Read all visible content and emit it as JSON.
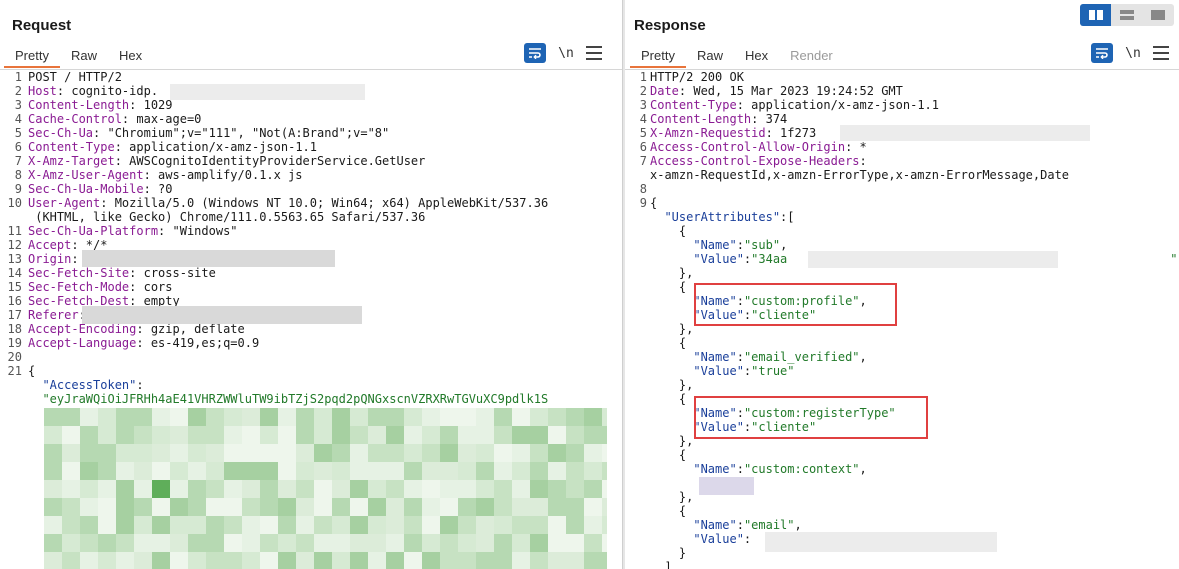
{
  "request": {
    "title": "Request",
    "tabs": [
      "Pretty",
      "Raw",
      "Hex"
    ],
    "newline_toggle": "\\n",
    "lines": [
      {
        "n": "1",
        "parts": [
          {
            "t": "POST / HTTP/2",
            "c": ""
          }
        ]
      },
      {
        "n": "2",
        "parts": [
          {
            "t": "Host",
            "c": "hn"
          },
          {
            "t": ": cognito-idp.",
            "c": ""
          }
        ]
      },
      {
        "n": "3",
        "parts": [
          {
            "t": "Content-Length",
            "c": "hn"
          },
          {
            "t": ": 1029",
            "c": ""
          }
        ]
      },
      {
        "n": "4",
        "parts": [
          {
            "t": "Cache-Control",
            "c": "hn"
          },
          {
            "t": ": max-age=0",
            "c": ""
          }
        ]
      },
      {
        "n": "5",
        "parts": [
          {
            "t": "Sec-Ch-Ua",
            "c": "hn"
          },
          {
            "t": ": \"Chromium\";v=\"111\", \"Not(A:Brand\";v=\"8\"",
            "c": ""
          }
        ]
      },
      {
        "n": "6",
        "parts": [
          {
            "t": "Content-Type",
            "c": "hn"
          },
          {
            "t": ": application/x-amz-json-1.1",
            "c": ""
          }
        ]
      },
      {
        "n": "7",
        "parts": [
          {
            "t": "X-Amz-Target",
            "c": "hn"
          },
          {
            "t": ": AWSCognitoIdentityProviderService.GetUser",
            "c": ""
          }
        ]
      },
      {
        "n": "8",
        "parts": [
          {
            "t": "X-Amz-User-Agent",
            "c": "hn"
          },
          {
            "t": ": aws-amplify/0.1.x js",
            "c": ""
          }
        ]
      },
      {
        "n": "9",
        "parts": [
          {
            "t": "Sec-Ch-Ua-Mobile",
            "c": "hn"
          },
          {
            "t": ": ?0",
            "c": ""
          }
        ]
      },
      {
        "n": "10",
        "parts": [
          {
            "t": "User-Agent",
            "c": "hn"
          },
          {
            "t": ": Mozilla/5.0 (Windows NT 10.0; Win64; x64) AppleWebKit/537.36",
            "c": ""
          }
        ]
      },
      {
        "n": "",
        "parts": [
          {
            "t": " (KHTML, like Gecko) Chrome/111.0.5563.65 Safari/537.36",
            "c": ""
          }
        ]
      },
      {
        "n": "11",
        "parts": [
          {
            "t": "Sec-Ch-Ua-Platform",
            "c": "hn"
          },
          {
            "t": ": \"Windows\"",
            "c": ""
          }
        ]
      },
      {
        "n": "12",
        "parts": [
          {
            "t": "Accept",
            "c": "hn"
          },
          {
            "t": ": */*",
            "c": ""
          }
        ]
      },
      {
        "n": "13",
        "parts": [
          {
            "t": "Origin",
            "c": "hn"
          },
          {
            "t": ":",
            "c": ""
          }
        ]
      },
      {
        "n": "14",
        "parts": [
          {
            "t": "Sec-Fetch-Site",
            "c": "hn"
          },
          {
            "t": ": cross-site",
            "c": ""
          }
        ]
      },
      {
        "n": "15",
        "parts": [
          {
            "t": "Sec-Fetch-Mode",
            "c": "hn"
          },
          {
            "t": ": cors",
            "c": ""
          }
        ]
      },
      {
        "n": "16",
        "parts": [
          {
            "t": "Sec-Fetch-Dest",
            "c": "hn"
          },
          {
            "t": ": empty",
            "c": ""
          }
        ]
      },
      {
        "n": "17",
        "parts": [
          {
            "t": "Referer",
            "c": "hn"
          },
          {
            "t": ":",
            "c": ""
          }
        ]
      },
      {
        "n": "18",
        "parts": [
          {
            "t": "Accept-Encoding",
            "c": "hn"
          },
          {
            "t": ": gzip, deflate",
            "c": ""
          }
        ]
      },
      {
        "n": "19",
        "parts": [
          {
            "t": "Accept-Language",
            "c": "hn"
          },
          {
            "t": ": es-419,es;q=0.9",
            "c": ""
          }
        ]
      },
      {
        "n": "20",
        "parts": []
      },
      {
        "n": "21",
        "parts": [
          {
            "t": "{",
            "c": "jp"
          }
        ]
      },
      {
        "n": "",
        "parts": [
          {
            "t": "  \"AccessToken\"",
            "c": "jk"
          },
          {
            "t": ":",
            "c": "jp"
          }
        ]
      },
      {
        "n": "",
        "parts": [
          {
            "t": "  \"eyJraWQiOiJFRHh4aE41VHRZWWluTW9ibTZjS2pqd2pQNGxscnVZRXRwTGVuXC9pdlk1S",
            "c": "js"
          }
        ]
      }
    ]
  },
  "response": {
    "title": "Response",
    "tabs": [
      "Pretty",
      "Raw",
      "Hex",
      "Render"
    ],
    "newline_toggle": "\\n",
    "lines": [
      {
        "n": "1",
        "parts": [
          {
            "t": "HTTP/2 200 OK",
            "c": ""
          }
        ]
      },
      {
        "n": "2",
        "parts": [
          {
            "t": "Date",
            "c": "hn"
          },
          {
            "t": ": Wed, 15 Mar 2023 19:24:52 GMT",
            "c": ""
          }
        ]
      },
      {
        "n": "3",
        "parts": [
          {
            "t": "Content-Type",
            "c": "hn"
          },
          {
            "t": ": application/x-amz-json-1.1",
            "c": ""
          }
        ]
      },
      {
        "n": "4",
        "parts": [
          {
            "t": "Content-Length",
            "c": "hn"
          },
          {
            "t": ": 374",
            "c": ""
          }
        ]
      },
      {
        "n": "5",
        "parts": [
          {
            "t": "X-Amzn-Requestid",
            "c": "hn"
          },
          {
            "t": ": 1f273",
            "c": ""
          }
        ]
      },
      {
        "n": "6",
        "parts": [
          {
            "t": "Access-Control-Allow-Origin",
            "c": "hn"
          },
          {
            "t": ": *",
            "c": ""
          }
        ]
      },
      {
        "n": "7",
        "parts": [
          {
            "t": "Access-Control-Expose-Headers",
            "c": "hn"
          },
          {
            "t": ":",
            "c": ""
          }
        ]
      },
      {
        "n": "",
        "parts": [
          {
            "t": "x-amzn-RequestId,x-amzn-ErrorType,x-amzn-ErrorMessage,Date",
            "c": ""
          }
        ]
      },
      {
        "n": "8",
        "parts": []
      },
      {
        "n": "9",
        "parts": [
          {
            "t": "{",
            "c": "jp"
          }
        ]
      },
      {
        "n": "",
        "parts": [
          {
            "t": "  \"UserAttributes\"",
            "c": "jk"
          },
          {
            "t": ":[",
            "c": "jp"
          }
        ]
      },
      {
        "n": "",
        "parts": [
          {
            "t": "    {",
            "c": "jp"
          }
        ]
      },
      {
        "n": "",
        "parts": [
          {
            "t": "      \"Name\"",
            "c": "jk"
          },
          {
            "t": ":",
            "c": "jp"
          },
          {
            "t": "\"sub\"",
            "c": "js"
          },
          {
            "t": ",",
            "c": "jp"
          }
        ]
      },
      {
        "n": "",
        "parts": [
          {
            "t": "      \"Value\"",
            "c": "jk"
          },
          {
            "t": ":",
            "c": "jp"
          },
          {
            "t": "\"34aa",
            "c": "js"
          },
          {
            "t": "                                                     ",
            "c": ""
          },
          {
            "t": "\"",
            "c": "js"
          }
        ]
      },
      {
        "n": "",
        "parts": [
          {
            "t": "    },",
            "c": "jp"
          }
        ]
      },
      {
        "n": "",
        "parts": [
          {
            "t": "    {",
            "c": "jp"
          }
        ]
      },
      {
        "n": "",
        "parts": [
          {
            "t": "      \"Name\"",
            "c": "jk"
          },
          {
            "t": ":",
            "c": "jp"
          },
          {
            "t": "\"custom:profile\"",
            "c": "js"
          },
          {
            "t": ",",
            "c": "jp"
          }
        ]
      },
      {
        "n": "",
        "parts": [
          {
            "t": "      \"Value\"",
            "c": "jk"
          },
          {
            "t": ":",
            "c": "jp"
          },
          {
            "t": "\"cliente\"",
            "c": "js"
          }
        ]
      },
      {
        "n": "",
        "parts": [
          {
            "t": "    },",
            "c": "jp"
          }
        ]
      },
      {
        "n": "",
        "parts": [
          {
            "t": "    {",
            "c": "jp"
          }
        ]
      },
      {
        "n": "",
        "parts": [
          {
            "t": "      \"Name\"",
            "c": "jk"
          },
          {
            "t": ":",
            "c": "jp"
          },
          {
            "t": "\"email_verified\"",
            "c": "js"
          },
          {
            "t": ",",
            "c": "jp"
          }
        ]
      },
      {
        "n": "",
        "parts": [
          {
            "t": "      \"Value\"",
            "c": "jk"
          },
          {
            "t": ":",
            "c": "jp"
          },
          {
            "t": "\"true\"",
            "c": "js"
          }
        ]
      },
      {
        "n": "",
        "parts": [
          {
            "t": "    },",
            "c": "jp"
          }
        ]
      },
      {
        "n": "",
        "parts": [
          {
            "t": "    {",
            "c": "jp"
          }
        ]
      },
      {
        "n": "",
        "parts": [
          {
            "t": "      \"Name\"",
            "c": "jk"
          },
          {
            "t": ":",
            "c": "jp"
          },
          {
            "t": "\"custom:registerType\"",
            "c": "js"
          }
        ]
      },
      {
        "n": "",
        "parts": [
          {
            "t": "      \"Value\"",
            "c": "jk"
          },
          {
            "t": ":",
            "c": "jp"
          },
          {
            "t": "\"cliente\"",
            "c": "js"
          }
        ]
      },
      {
        "n": "",
        "parts": [
          {
            "t": "    },",
            "c": "jp"
          }
        ]
      },
      {
        "n": "",
        "parts": [
          {
            "t": "    {",
            "c": "jp"
          }
        ]
      },
      {
        "n": "",
        "parts": [
          {
            "t": "      \"Name\"",
            "c": "jk"
          },
          {
            "t": ":",
            "c": "jp"
          },
          {
            "t": "\"custom:context\"",
            "c": "js"
          },
          {
            "t": ",",
            "c": "jp"
          }
        ]
      },
      {
        "n": "",
        "parts": []
      },
      {
        "n": "",
        "parts": [
          {
            "t": "    },",
            "c": "jp"
          }
        ]
      },
      {
        "n": "",
        "parts": [
          {
            "t": "    {",
            "c": "jp"
          }
        ]
      },
      {
        "n": "",
        "parts": [
          {
            "t": "      \"Name\"",
            "c": "jk"
          },
          {
            "t": ":",
            "c": "jp"
          },
          {
            "t": "\"email\"",
            "c": "js"
          },
          {
            "t": ",",
            "c": "jp"
          }
        ]
      },
      {
        "n": "",
        "parts": [
          {
            "t": "      \"Value\"",
            "c": "jk"
          },
          {
            "t": ":",
            "c": "jp"
          }
        ]
      },
      {
        "n": "",
        "parts": [
          {
            "t": "    }",
            "c": "jp"
          }
        ]
      },
      {
        "n": "",
        "parts": [
          {
            "t": "  ]",
            "c": "jp"
          }
        ]
      }
    ]
  },
  "colors": {
    "accent": "#1e64b4",
    "active_tab": "#e8743b",
    "highlight_box": "#e04040",
    "header_name": "#8a1b93",
    "json_key": "#1a3f9a",
    "json_string": "#227a2a"
  }
}
